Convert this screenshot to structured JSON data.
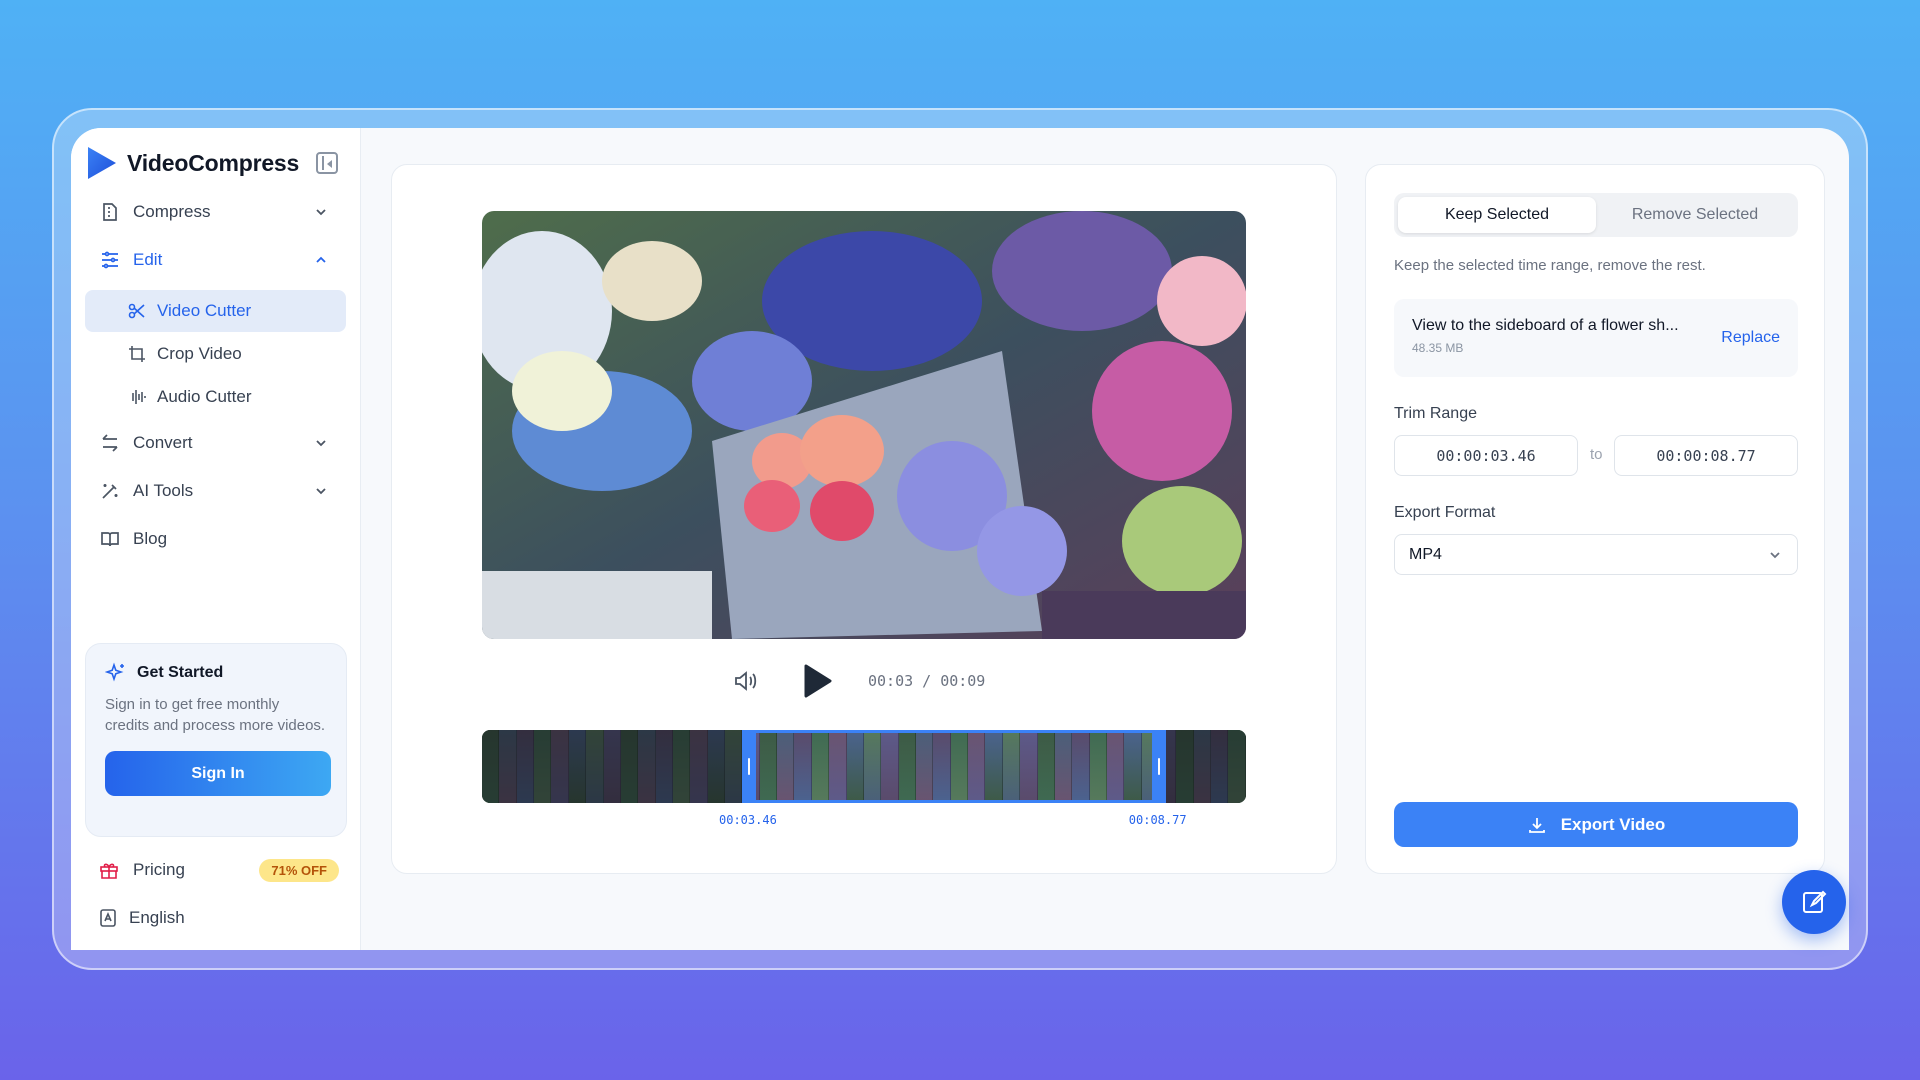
{
  "brand": {
    "name": "VideoCompress"
  },
  "nav": {
    "compress": "Compress",
    "edit": "Edit",
    "edit_items": [
      "Video Cutter",
      "Crop Video",
      "Audio Cutter"
    ],
    "convert": "Convert",
    "ai_tools": "AI Tools",
    "blog": "Blog"
  },
  "get_started": {
    "title": "Get Started",
    "text": "Sign in to get free monthly credits and process more videos.",
    "button": "Sign In"
  },
  "pricing": {
    "label": "Pricing",
    "badge": "71% OFF"
  },
  "language": {
    "label": "English"
  },
  "player": {
    "current": "00:03",
    "separator": "/",
    "duration": "00:09",
    "sel_start_label": "00:03.46",
    "sel_end_label": "00:08.77",
    "selection": {
      "start_seconds": 3.46,
      "end_seconds": 8.77,
      "total_seconds": 9.9
    }
  },
  "settings": {
    "segment": {
      "keep": "Keep Selected",
      "remove": "Remove Selected",
      "active": "keep"
    },
    "description": "Keep the selected time range, remove the rest.",
    "file": {
      "name": "View to the sideboard of a flower sh...",
      "size": "48.35 MB",
      "replace": "Replace"
    },
    "trim_label": "Trim Range",
    "trim_start": "00:00:03.46",
    "trim_to": "to",
    "trim_end": "00:00:08.77",
    "format_label": "Export Format",
    "format_value": "MP4",
    "export_button": "Export Video"
  },
  "colors": {
    "accent": "#2563eb",
    "badge_bg": "#fde68a",
    "badge_text": "#b45309"
  }
}
